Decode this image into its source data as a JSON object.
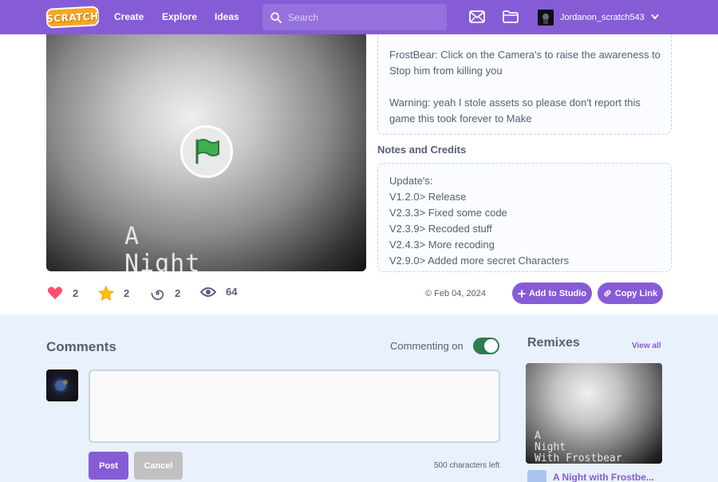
{
  "navbar": {
    "logo_text": "SCRATCH",
    "links": [
      "Create",
      "Explore",
      "Ideas"
    ],
    "search_placeholder": "Search",
    "username": "Jordanon_scratch543",
    "icons": [
      "messages-icon",
      "my-stuff-folder-icon",
      "chevron-down-icon"
    ]
  },
  "player": {
    "title_art": "A\nNight\nWith Frostbear"
  },
  "description": {
    "para1": "FrostBear: Click on the Camera's to raise the awareness to Stop him from killing you",
    "para2": "Warning: yeah I stole assets so please don't report this game this took forever to Make"
  },
  "notes": {
    "heading": "Notes and Credits",
    "lines": [
      "Update's:",
      "V1.2.0> Release",
      "V2.3.3> Fixed some code",
      "V2.3.9> Recoded stuff",
      "V2.4.3> More recoding",
      "V2.9.0> Added more secret Characters"
    ]
  },
  "stats": {
    "loves": "2",
    "favorites": "2",
    "remixes": "2",
    "views": "64",
    "date": "© Feb 04, 2024"
  },
  "actions": {
    "add_to_studio": "Add to Studio",
    "copy_link": "Copy Link"
  },
  "comments": {
    "heading": "Comments",
    "commenting_label": "Commenting on",
    "commenting_enabled": true,
    "post": "Post",
    "cancel": "Cancel",
    "chars_left": "500 characters left"
  },
  "remixes": {
    "heading": "Remixes",
    "view_all": "View all",
    "thumb_art": "A\nNight\nWith Frostbear",
    "items": [
      {
        "title": "A Night with Frostbe..."
      }
    ]
  },
  "colors": {
    "brand_purple": "#855cd6",
    "toggle_green": "#2e7d4f",
    "love_red": "#ff4d6d",
    "star_yellow": "#ffbf00"
  }
}
